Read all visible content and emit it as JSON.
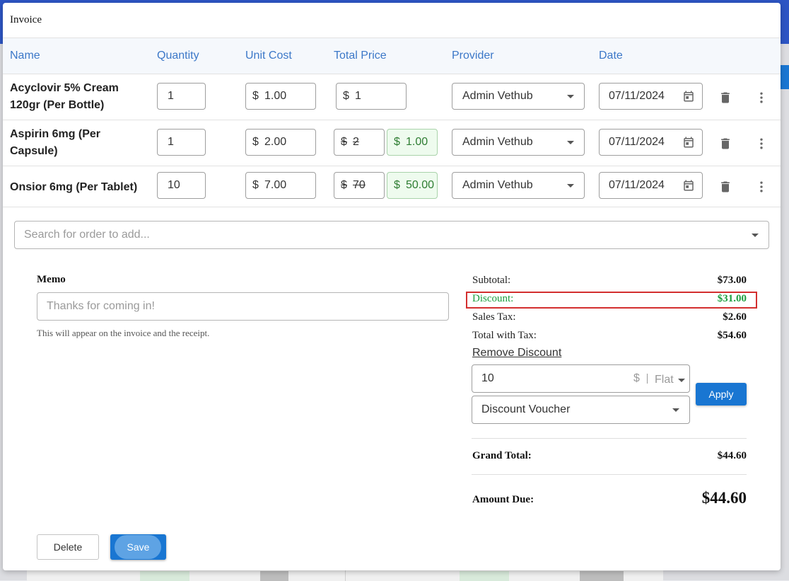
{
  "dialog": {
    "title": "Invoice"
  },
  "table": {
    "columns": [
      "Name",
      "Quantity",
      "Unit Cost",
      "Total Price",
      "Provider",
      "Date"
    ],
    "rows": [
      {
        "name_line1": "Acyclovir 5% Cream",
        "name_line2": "120gr (Per Bottle)",
        "quantity": "1",
        "currency": "$",
        "unit_cost": "1.00",
        "total_price": "1",
        "discounted_price": "",
        "provider": "Admin Vethub",
        "date": "07/11/2024"
      },
      {
        "name_line1": "Aspirin 6mg (Per",
        "name_line2": "Capsule)",
        "quantity": "1",
        "currency": "$",
        "unit_cost": "2.00",
        "total_price": "2",
        "discounted_price": "1.00",
        "provider": "Admin Vethub",
        "date": "07/11/2024"
      },
      {
        "name_line1": "Onsior 6mg (Per Tablet)",
        "name_line2": "",
        "quantity": "10",
        "currency": "$",
        "unit_cost": "7.00",
        "total_price": "70",
        "discounted_price": "50.00",
        "provider": "Admin Vethub",
        "date": "07/11/2024"
      }
    ]
  },
  "search": {
    "placeholder": "Search for order to add..."
  },
  "memo": {
    "label": "Memo",
    "placeholder": "Thanks for coming in!",
    "help": "This will appear on the invoice and the receipt."
  },
  "summary": {
    "subtotal_label": "Subtotal:",
    "subtotal_value": "$73.00",
    "discount_label": "Discount:",
    "discount_value": "$31.00",
    "tax_label": "Sales Tax:",
    "tax_value": "$2.60",
    "total_tax_label": "Total with Tax:",
    "total_tax_value": "$54.60",
    "remove_discount": "Remove Discount",
    "discount_amount": "10",
    "discount_symbol": "$",
    "discount_type": "Flat",
    "voucher": "Discount Voucher",
    "apply_label": "Apply",
    "grand_total_label": "Grand Total:",
    "grand_total_value": "$44.60",
    "amount_due_label": "Amount Due:",
    "amount_due_value": "$44.60"
  },
  "actions": {
    "delete_label": "Delete",
    "save_label": "Save"
  },
  "colors": {
    "accent": "#1976d2",
    "header_text": "#3c78c8",
    "discount_green": "#1b9e3e",
    "highlight_red": "#d32f2f"
  }
}
